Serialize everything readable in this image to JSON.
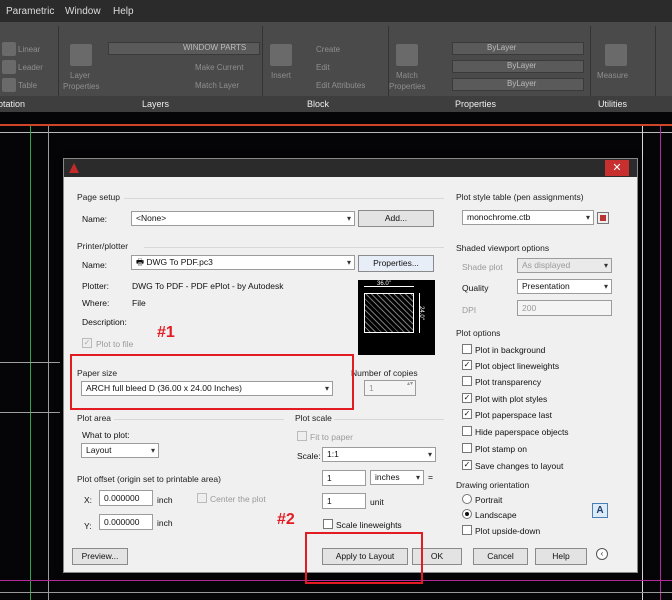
{
  "menubar": {
    "items": [
      "Parametric",
      "Window",
      "Help"
    ]
  },
  "ribbon": {
    "panels": [
      "otation",
      "Layers",
      "Block",
      "Properties",
      "Utilities"
    ],
    "tools": {
      "linear": "Linear",
      "leader": "Leader",
      "table": "Table",
      "layer_properties_1": "Layer",
      "layer_properties_2": "Properties",
      "layer_combo": "WINDOW PARTS",
      "make_current": "Make Current",
      "match_layer": "Match Layer",
      "insert": "Insert",
      "create": "Create",
      "edit": "Edit",
      "edit_attributes": "Edit Attributes",
      "match_props_1": "Match",
      "match_props_2": "Properties",
      "bylayer_1": "ByLayer",
      "bylayer_2": "ByLayer",
      "bylayer_3": "ByLayer",
      "measure": "Measure"
    }
  },
  "dialog": {
    "page_setup": {
      "title": "Page setup",
      "name_label": "Name:",
      "name_value": "<None>",
      "add_button": "Add..."
    },
    "printer": {
      "title": "Printer/plotter",
      "name_label": "Name:",
      "name_value": "DWG To PDF.pc3",
      "properties_button": "Properties...",
      "plotter_label": "Plotter:",
      "plotter_value": "DWG To PDF - PDF ePlot - by Autodesk",
      "where_label": "Where:",
      "where_value": "File",
      "description_label": "Description:",
      "plot_to_file": "Plot to file",
      "preview_width": "36.0\"",
      "preview_height": "24.0\""
    },
    "paper_size": {
      "title": "Paper size",
      "value": "ARCH full bleed D (36.00 x 24.00 Inches)"
    },
    "copies": {
      "title": "Number of copies",
      "value": "1"
    },
    "plot_area": {
      "title": "Plot area",
      "what_label": "What to plot:",
      "what_value": "Layout"
    },
    "plot_offset": {
      "title": "Plot offset (origin set to printable area)",
      "x_label": "X:",
      "x_value": "0.000000",
      "x_unit": "inch",
      "y_label": "Y:",
      "y_value": "0.000000",
      "y_unit": "inch",
      "center": "Center the plot"
    },
    "plot_scale": {
      "title": "Plot scale",
      "fit": "Fit to paper",
      "scale_label": "Scale:",
      "scale_value": "1:1",
      "inches_value": "1",
      "inches_unit": "inches",
      "unit_value": "1",
      "unit_label": "unit",
      "scale_lineweights": "Scale lineweights"
    },
    "plot_style": {
      "title": "Plot style table (pen assignments)",
      "value": "monochrome.ctb"
    },
    "shaded": {
      "title": "Shaded viewport options",
      "shade_label": "Shade plot",
      "shade_value": "As displayed",
      "quality_label": "Quality",
      "quality_value": "Presentation",
      "dpi_label": "DPI",
      "dpi_value": "200"
    },
    "plot_options": {
      "title": "Plot options",
      "items": [
        "Plot in background",
        "Plot object lineweights",
        "Plot transparency",
        "Plot with plot styles",
        "Plot paperspace last",
        "Hide paperspace objects",
        "Plot stamp on",
        "Save changes to layout"
      ]
    },
    "orientation": {
      "title": "Drawing orientation",
      "portrait": "Portrait",
      "landscape": "Landscape",
      "upside_down": "Plot upside-down"
    },
    "buttons": {
      "preview": "Preview...",
      "apply": "Apply to Layout",
      "ok": "OK",
      "cancel": "Cancel",
      "help": "Help"
    }
  },
  "annotations": {
    "a1": "#1",
    "a2": "#2"
  }
}
